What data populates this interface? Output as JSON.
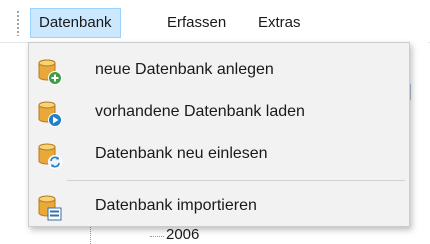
{
  "menubar": {
    "items": [
      {
        "label": "Datenbank"
      },
      {
        "label": "Erfassen"
      },
      {
        "label": "Extras"
      }
    ]
  },
  "dropdown": {
    "items": [
      {
        "label": "neue Datenbank anlegen",
        "icon": "database-add-icon"
      },
      {
        "label": "vorhandene Datenbank laden",
        "icon": "database-load-icon"
      },
      {
        "label": "Datenbank neu einlesen",
        "icon": "database-refresh-icon"
      },
      {
        "label": "Datenbank importieren",
        "icon": "database-import-icon"
      }
    ]
  },
  "tree": {
    "visible_year": "2006"
  },
  "colors": {
    "menu_active_bg": "#cce8ff",
    "menu_active_border": "#99d1ff",
    "dropdown_bg": "#f2f2f2",
    "db_gold": "#e8a93a",
    "add_green": "#3f9b48",
    "load_blue": "#1f7fc8",
    "import_blue": "#3a6ea5"
  }
}
